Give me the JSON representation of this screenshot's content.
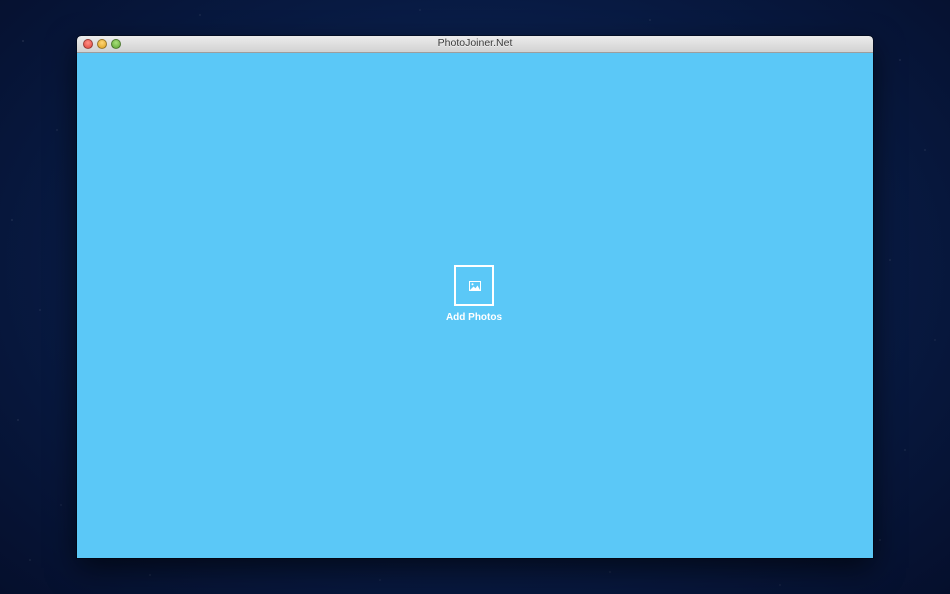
{
  "window": {
    "title": "PhotoJoiner.Net"
  },
  "main": {
    "add_photos": {
      "label": "Add Photos",
      "icon": "image-icon"
    }
  },
  "colors": {
    "canvas_background": "#5bc8f7",
    "accent": "#ffffff",
    "desktop_background": "#0d2556"
  }
}
